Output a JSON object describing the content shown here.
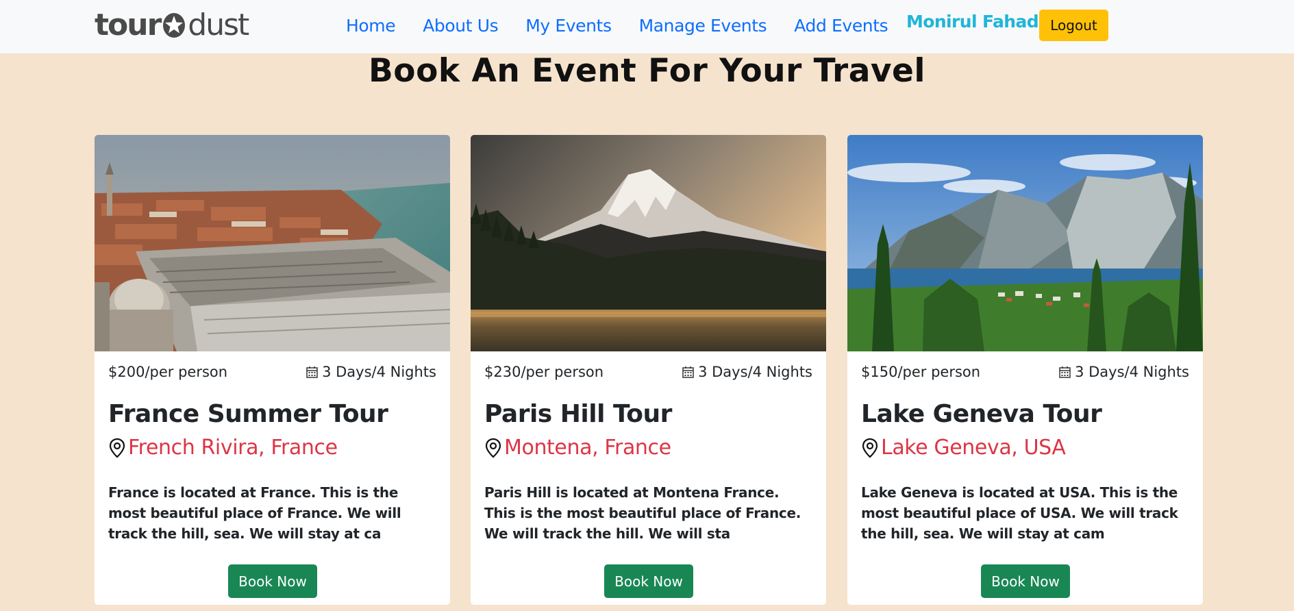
{
  "navbar": {
    "logo": {
      "part1": "tour",
      "part2": "dust"
    },
    "links": [
      "Home",
      "About Us",
      "My Events",
      "Manage Events",
      "Add Events"
    ],
    "user_name": "Monirul Fahad",
    "logout_label": "Logout"
  },
  "main": {
    "title": "Book An Event For Your Travel",
    "cards": [
      {
        "price": "$200/per person",
        "duration": "3 Days/4 Nights",
        "title": "France Summer Tour",
        "location": "French Rivira, France",
        "description": "France is located at France. This is the most beautiful place of France. We will track the hill, sea. We will stay at ca",
        "button": "Book Now"
      },
      {
        "price": "$230/per person",
        "duration": "3 Days/4 Nights",
        "title": "Paris Hill Tour",
        "location": "Montena, France",
        "description": "Paris Hill is located at Montena France. This is the most beautiful place of France. We will track the hill. We will sta",
        "button": "Book Now"
      },
      {
        "price": "$150/per person",
        "duration": "3 Days/4 Nights",
        "title": "Lake Geneva Tour",
        "location": "Lake Geneva, USA",
        "description": "Lake Geneva is located at USA. This is the most beautiful place of USA. We will track the hill, sea. We will stay at cam",
        "button": "Book Now"
      }
    ]
  },
  "colors": {
    "page_bg": "#f5e3cd",
    "nav_link": "#0d6efd",
    "user_name": "#1fb5d9",
    "logout_bg": "#ffc107",
    "location": "#dc3545",
    "book_button": "#198754"
  },
  "icons": [
    "star-logo-icon",
    "calendar-icon",
    "map-pin-icon"
  ]
}
